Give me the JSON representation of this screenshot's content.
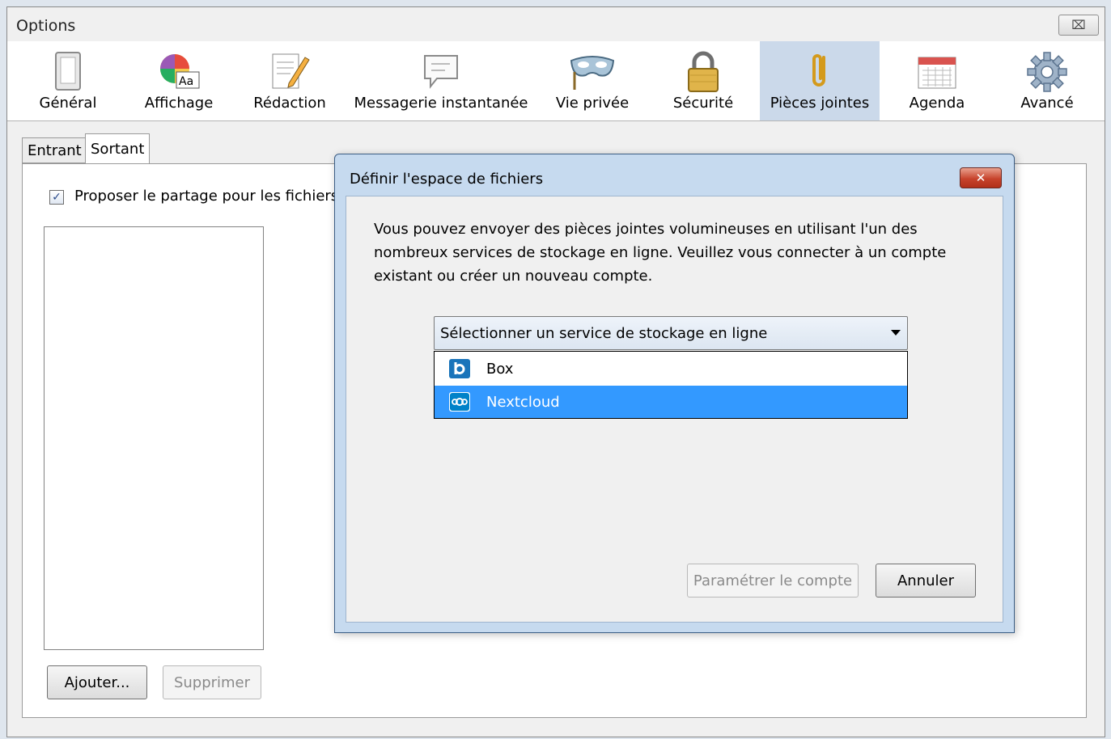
{
  "window": {
    "title": "Options",
    "close_glyph": "⌧"
  },
  "toolbar": {
    "items": [
      {
        "label": "Général",
        "icon": "general-switch-icon"
      },
      {
        "label": "Affichage",
        "icon": "display-palette-icon"
      },
      {
        "label": "Rédaction",
        "icon": "compose-pencil-icon"
      },
      {
        "label": "Messagerie instantanée",
        "icon": "chat-bubble-icon"
      },
      {
        "label": "Vie privée",
        "icon": "privacy-mask-icon"
      },
      {
        "label": "Sécurité",
        "icon": "security-lock-icon"
      },
      {
        "label": "Pièces jointes",
        "icon": "paperclip-icon",
        "selected": true
      },
      {
        "label": "Agenda",
        "icon": "calendar-icon"
      },
      {
        "label": "Avancé",
        "icon": "gear-icon"
      }
    ]
  },
  "tabs": {
    "incoming": "Entrant",
    "outgoing": "Sortant"
  },
  "outgoing": {
    "checkbox_label": "Proposer le partage pour les fichiers",
    "checkbox_checked": true,
    "add_button": "Ajouter...",
    "remove_button": "Supprimer"
  },
  "dialog": {
    "title": "Définir l'espace de fichiers",
    "close_glyph": "✕",
    "description": "Vous pouvez envoyer des pièces jointes volumineuses en utilisant l'un des nombreux services de stockage en ligne. Veuillez vous connecter à un compte existant ou créer un nouveau compte.",
    "select_placeholder": "Sélectionner un service de stockage en ligne",
    "options": [
      {
        "label": "Box",
        "icon": "box-icon",
        "highlighted": false
      },
      {
        "label": "Nextcloud",
        "icon": "nextcloud-icon",
        "highlighted": true
      }
    ],
    "setup_button": "Paramétrer le compte",
    "cancel_button": "Annuler"
  },
  "colors": {
    "selected_tab_bg": "#cbd9ea",
    "highlight": "#3399ff",
    "box_brand": "#1a74ba",
    "nextcloud_brand": "#0082c9"
  }
}
